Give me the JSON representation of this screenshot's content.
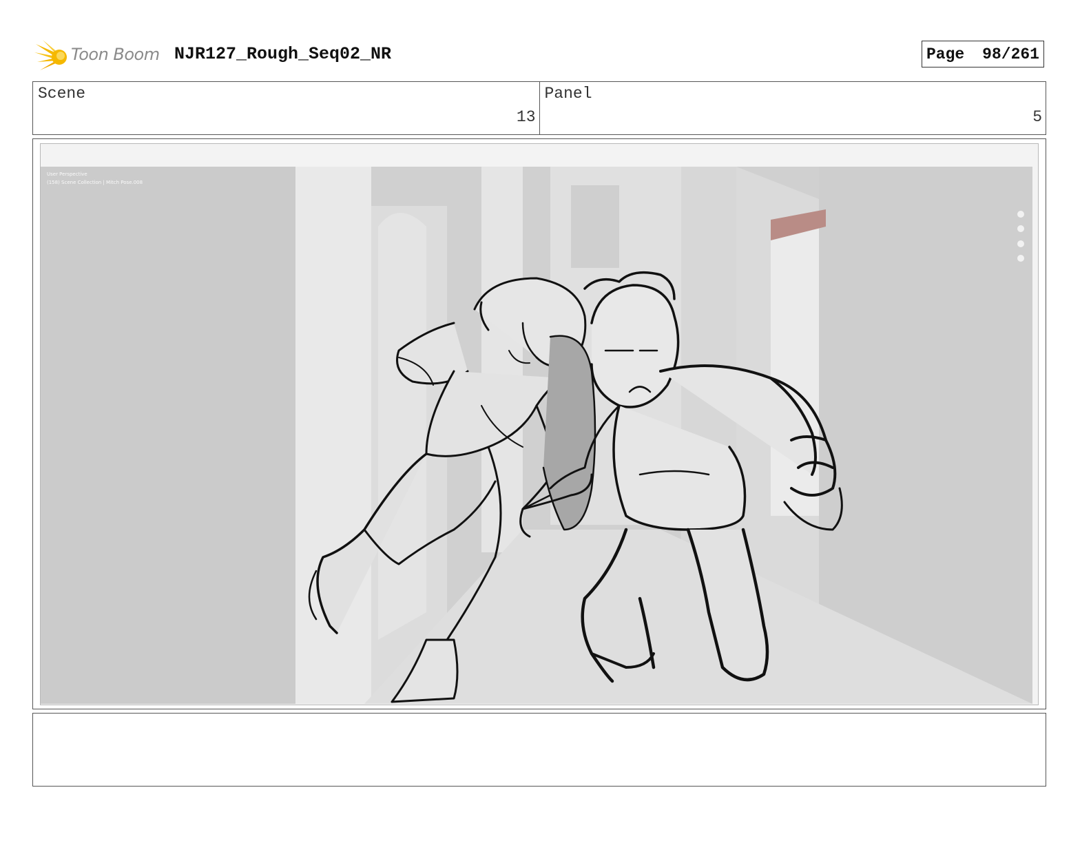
{
  "header": {
    "logo_text": "Toon Boom",
    "project_title": "NJR127_Rough_Seq02_NR",
    "page_label": "Page",
    "page_number": "98/261"
  },
  "info": {
    "scene_label": "Scene",
    "scene_value": "13",
    "panel_label": "Panel",
    "panel_value": "5"
  },
  "viewport": {
    "mode_label": "User Perspective",
    "collection_label": "(158) Scene Collection | Mitch Pose.008"
  },
  "notes": {
    "text": ""
  },
  "colors": {
    "logo_accent": "#f5b800",
    "viewport_bg": "#d0d0d0",
    "sketch_line": "#111111"
  }
}
